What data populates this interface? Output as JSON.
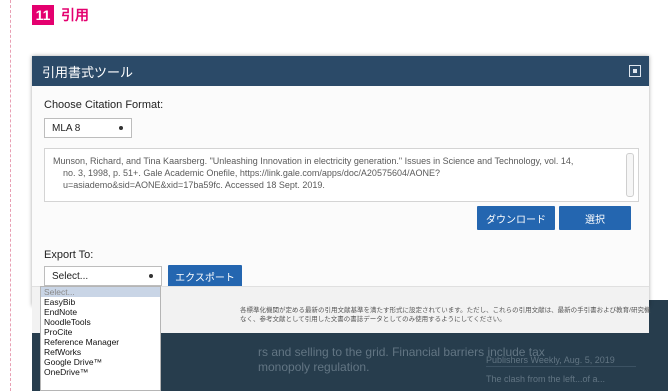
{
  "section": {
    "number": "11",
    "title": "引用"
  },
  "dialog": {
    "title": "引用書式ツール",
    "format_label": "Choose Citation Format:",
    "format_value": "MLA 8",
    "citation_lines": [
      "Munson, Richard, and Tina Kaarsberg. \"Unleashing Innovation in electricity generation.\" Issues in Science and Technology, vol. 14,",
      "no. 3, 1998, p. 51+. Gale Academic Onefile, https://link.gale.com/apps/doc/A20575604/AONE?",
      "u=asiademo&sid=AONE&xid=17ba59fc. Accessed 18 Sept. 2019."
    ],
    "download_label": "ダウンロード",
    "select_label": "選択",
    "export_label": "Export To:",
    "export_value": "Select...",
    "export_button": "エクスポート",
    "notice_lines": [
      "各標準化機関が定める最新の引用文献基準を満たす形式に設定されています。ただし、これらの引用文献は、最新の手引書および教育/研究機",
      "なく、参考文献として引用した文書の書誌データとしてのみ使用するようにしてください。"
    ]
  },
  "export_options": [
    "Select...",
    "EasyBib",
    "EndNote",
    "NoodleTools",
    "ProCite",
    "Reference Manager",
    "RefWorks",
    "Google Drive™",
    "OneDrive™"
  ],
  "background": {
    "line1": "rs and selling to the grid. Financial barriers include tax",
    "line2": "monopoly regulation.",
    "right1": "Publishers Weekly, Aug. 5, 2019",
    "right2": "The clash from the left...of a..."
  },
  "colors": {
    "accent": "#e4006f",
    "header": "#2b4a68",
    "button": "#2466b0",
    "page_dark": "#273d4d"
  }
}
